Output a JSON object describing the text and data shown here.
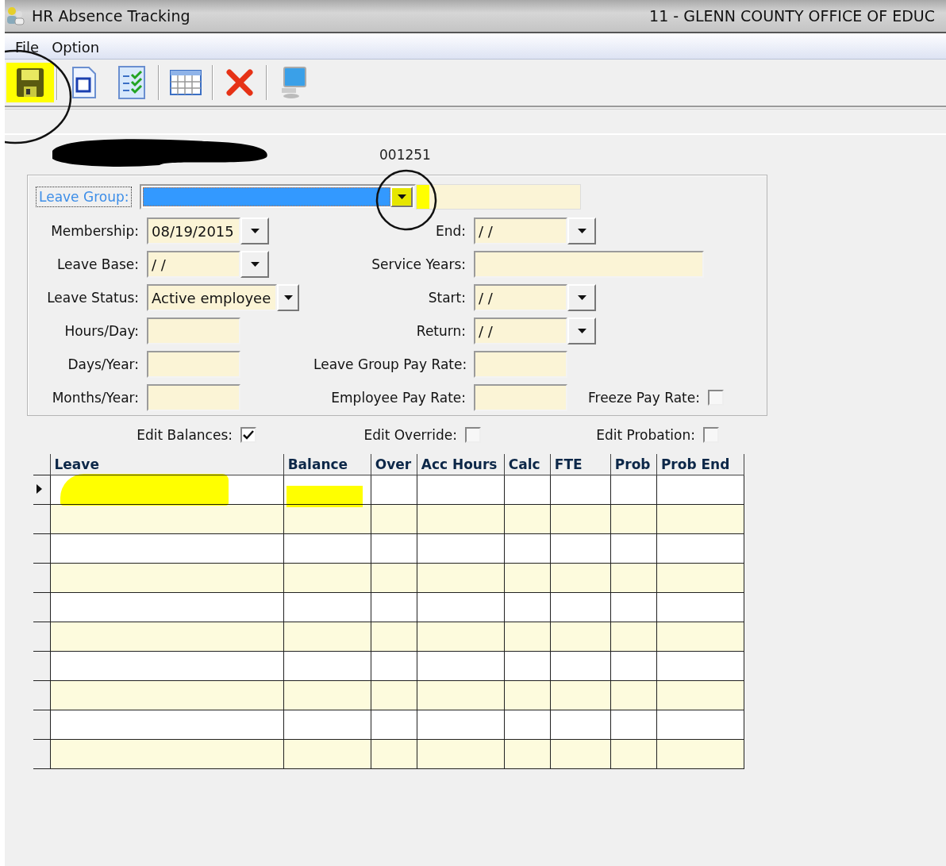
{
  "window": {
    "title": "HR Absence Tracking",
    "organization": "11 - GLENN COUNTY OFFICE OF EDUC"
  },
  "menu": [
    "File",
    "Option"
  ],
  "record_id": "001251",
  "leave_group": {
    "label": "Leave Group:",
    "focused": true
  },
  "left_fields": [
    {
      "label": "Membership:",
      "value": "08/19/2015",
      "kind": "date"
    },
    {
      "label": "Leave Base:",
      "value": "/ /",
      "kind": "date"
    },
    {
      "label": "Leave Status:",
      "value": "Active employee",
      "kind": "combo"
    },
    {
      "label": "Hours/Day:",
      "kind": "text"
    },
    {
      "label": "Days/Year:",
      "kind": "text"
    },
    {
      "label": "Months/Year:",
      "kind": "text"
    }
  ],
  "right_fields": [
    {
      "label": "End:",
      "value": "/ /",
      "kind": "date"
    },
    {
      "label": "Service Years:",
      "kind": "wide"
    },
    {
      "label": "Start:",
      "value": "/ /",
      "kind": "date"
    },
    {
      "label": "Return:",
      "value": "/ /",
      "kind": "date"
    },
    {
      "label": "Leave Group Pay Rate:",
      "kind": "text"
    },
    {
      "label": "Employee Pay Rate:",
      "kind": "text"
    }
  ],
  "freeze_pay_rate": {
    "label": "Freeze Pay Rate:",
    "checked": false
  },
  "edit_options": [
    {
      "label": "Edit Balances:",
      "checked": true
    },
    {
      "label": "Edit Override:",
      "checked": false
    },
    {
      "label": "Edit Probation:",
      "checked": false
    }
  ],
  "table": {
    "columns": [
      "Leave",
      "Balance",
      "Over",
      "Acc Hours",
      "Calc",
      "FTE",
      "Prob",
      "Prob End"
    ],
    "rows": [
      {
        "selected": true
      },
      {
        "selected": false
      },
      {
        "selected": false
      },
      {
        "selected": false
      },
      {
        "selected": false
      },
      {
        "selected": false
      },
      {
        "selected": false
      },
      {
        "selected": false
      },
      {
        "selected": false
      },
      {
        "selected": false
      }
    ]
  }
}
